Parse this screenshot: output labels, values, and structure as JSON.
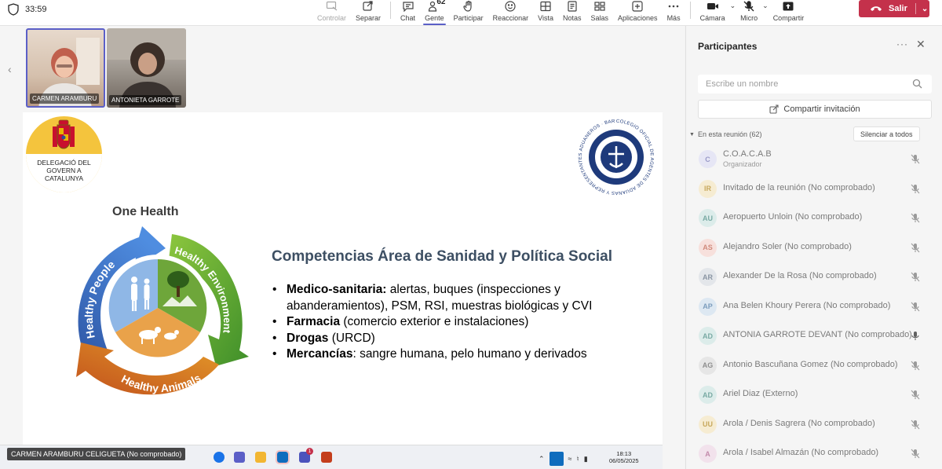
{
  "header": {
    "timer": "33:59",
    "tools": [
      {
        "id": "controlar",
        "label": "Controlar",
        "disabled": true
      },
      {
        "id": "separar",
        "label": "Separar"
      },
      {
        "id": "chat",
        "label": "Chat"
      },
      {
        "id": "gente",
        "label": "Gente",
        "count": "62",
        "active": true
      },
      {
        "id": "participar",
        "label": "Participar"
      },
      {
        "id": "reaccionar",
        "label": "Reaccionar"
      },
      {
        "id": "vista",
        "label": "Vista"
      },
      {
        "id": "notas",
        "label": "Notas"
      },
      {
        "id": "salas",
        "label": "Salas"
      },
      {
        "id": "aplicaciones",
        "label": "Aplicaciones"
      },
      {
        "id": "mas",
        "label": "Más"
      }
    ],
    "devices": [
      {
        "id": "camara",
        "label": "Cámara"
      },
      {
        "id": "micro",
        "label": "Micro"
      },
      {
        "id": "compartir",
        "label": "Compartir"
      }
    ],
    "leave_label": "Salir",
    "accent": "#5b5fc7",
    "leave_color": "#c4314b"
  },
  "videos": [
    {
      "name": "CARMEN ARAMBURU"
    },
    {
      "name": "ANTONIETA GARROTE"
    }
  ],
  "slide": {
    "gov_logo_text": [
      "DELEGACIÓ DEL",
      "GOVERN A",
      "CATALUNYA"
    ],
    "seal_text": "COLEGIO OFICIAL DE AGENTES DE ADUANAS Y REPRESENTANTES ADUANEROS · BARCELONA ·",
    "onehealth_title": "One Health",
    "cycle_labels": [
      "Healthy People",
      "Healthy Environments",
      "Healthy Animals"
    ],
    "title": "Competencias Área de Sanidad y Política Social",
    "bullets": [
      {
        "bold": "Medico-sanitaria:",
        "text": " alertas, buques (inspecciones y abanderamientos), PSM, RSI, muestras biológicas y CVI"
      },
      {
        "bold": "Farmacia",
        "text": " (comercio exterior e instalaciones)"
      },
      {
        "bold": "Drogas",
        "text": " (URCD)"
      },
      {
        "bold": "Mercancías",
        "text": ": sangre humana, pelo humano y derivados"
      }
    ]
  },
  "taskbar": {
    "presenter": "CARMEN ARAMBURU CELIGUETA (No comprobado)",
    "time": "18:13",
    "date": "06/05/2025",
    "notification_count": "1"
  },
  "participants": {
    "title": "Participantes",
    "search_placeholder": "Escribe un nombre",
    "invite_label": "Compartir invitación",
    "section_label": "En esta reunión (62)",
    "mute_all_label": "Silenciar a todos",
    "list": [
      {
        "initials": "C",
        "name": "C.O.A.C.A.B",
        "role": "Organizador",
        "bg": "#e6e6f5",
        "fg": "#9a9ac8",
        "mic": "muted"
      },
      {
        "initials": "IR",
        "name": "Invitado de la reunión (No comprobado)",
        "bg": "#f6ecd2",
        "fg": "#c7a85c",
        "mic": "muted"
      },
      {
        "initials": "AU",
        "name": "Aeropuerto Unloin (No comprobado)",
        "bg": "#dcecea",
        "fg": "#79aaa4",
        "mic": "muted"
      },
      {
        "initials": "AS",
        "name": "Alejandro Soler (No comprobado)",
        "bg": "#f7e0dc",
        "fg": "#d08a7c",
        "mic": "muted"
      },
      {
        "initials": "AR",
        "name": "Alexander De la Rosa (No comprobado)",
        "bg": "#e3e6ea",
        "fg": "#8a95a3",
        "mic": "muted"
      },
      {
        "initials": "AP",
        "name": "Ana Belen Khoury Perera (No comprobado)",
        "bg": "#dde8f2",
        "fg": "#7c9dbd",
        "mic": "muted"
      },
      {
        "initials": "AD",
        "name": "ANTONIA GARROTE DEVANT (No comprobado)",
        "bg": "#dcecea",
        "fg": "#79aaa4",
        "mic": "on"
      },
      {
        "initials": "AG",
        "name": "Antonio Bascuñana Gomez (No comprobado)",
        "bg": "#e6e6e6",
        "fg": "#8e8e8e",
        "mic": "muted"
      },
      {
        "initials": "AD",
        "name": "Ariel Diaz (Externo)",
        "bg": "#dcecea",
        "fg": "#79aaa4",
        "mic": "muted"
      },
      {
        "initials": "UU",
        "name": "Arola / Denis Sagrera (No comprobado)",
        "bg": "#f6ecd2",
        "fg": "#c7a85c",
        "mic": "muted"
      },
      {
        "initials": "A",
        "name": "Arola / Isabel Almazán (No comprobado)",
        "bg": "#f2e2ec",
        "fg": "#c38aab",
        "mic": "muted"
      }
    ]
  }
}
